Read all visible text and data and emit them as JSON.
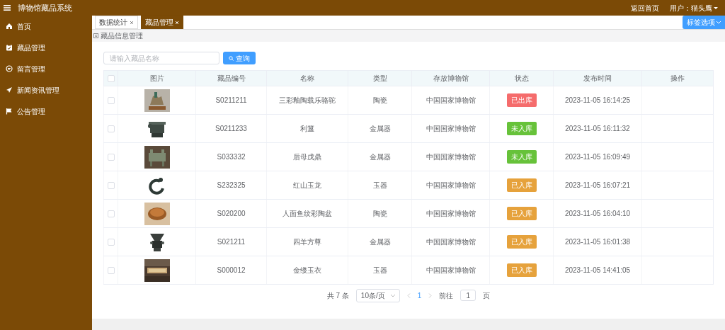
{
  "header": {
    "title": "博物馆藏品系统",
    "links": [
      "返回首页"
    ],
    "user": "用户：猫头鹰"
  },
  "sidebar": {
    "items": [
      {
        "label": "首页"
      },
      {
        "label": "藏品管理"
      },
      {
        "label": "留言管理"
      },
      {
        "label": "新闻资讯管理"
      },
      {
        "label": "公告管理"
      }
    ]
  },
  "tabs": [
    {
      "label": "数据统计",
      "selected": false
    },
    {
      "label": "藏品管理",
      "selected": true
    }
  ],
  "tab_options": "标签选项",
  "breadcrumb": "藏品信息管理",
  "search": {
    "placeholder": "请输入藏品名称",
    "button": "查询"
  },
  "table": {
    "select_all_checked": false,
    "columns": [
      "图片",
      "藏品编号",
      "名称",
      "类型",
      "存放博物馆",
      "状态",
      "发布时间",
      "操作"
    ],
    "rows": [
      {
        "checked": false,
        "code": "S0211211",
        "name": "三彩釉陶载乐骆驼",
        "type": "陶瓷",
        "museum": "中国国家博物馆",
        "status": {
          "text": "已出库",
          "color": "#f56c6c"
        },
        "time": "2023-11-05 16:14:25"
      },
      {
        "checked": false,
        "code": "S0211233",
        "name": "利簋",
        "type": "金属器",
        "museum": "中国国家博物馆",
        "status": {
          "text": "未入库",
          "color": "#67c23a"
        },
        "time": "2023-11-05 16:11:32"
      },
      {
        "checked": false,
        "code": "S033332",
        "name": "后母戊鼎",
        "type": "金属器",
        "museum": "中国国家博物馆",
        "status": {
          "text": "未入库",
          "color": "#67c23a"
        },
        "time": "2023-11-05 16:09:49"
      },
      {
        "checked": false,
        "code": "S232325",
        "name": "红山玉龙",
        "type": "玉器",
        "museum": "中国国家博物馆",
        "status": {
          "text": "已入库",
          "color": "#e6a23c"
        },
        "time": "2023-11-05 16:07:21"
      },
      {
        "checked": false,
        "code": "S020200",
        "name": "人面鱼纹彩陶盆",
        "type": "陶瓷",
        "museum": "中国国家博物馆",
        "status": {
          "text": "已入库",
          "color": "#e6a23c"
        },
        "time": "2023-11-05 16:04:10"
      },
      {
        "checked": false,
        "code": "S021211",
        "name": "四羊方尊",
        "type": "金属器",
        "museum": "中国国家博物馆",
        "status": {
          "text": "已入库",
          "color": "#e6a23c"
        },
        "time": "2023-11-05 16:01:38"
      },
      {
        "checked": false,
        "code": "S000012",
        "name": "金缕玉衣",
        "type": "玉器",
        "museum": "中国国家博物馆",
        "status": {
          "text": "已入库",
          "color": "#e6a23c"
        },
        "time": "2023-11-05 14:41:05"
      }
    ]
  },
  "pagination": {
    "total": "共 7 条",
    "page_size": "10条/页",
    "pages": [
      {
        "label": "1",
        "selected": true
      }
    ],
    "goto_label": "前往",
    "goto_value": "1",
    "goto_unit": "页"
  }
}
